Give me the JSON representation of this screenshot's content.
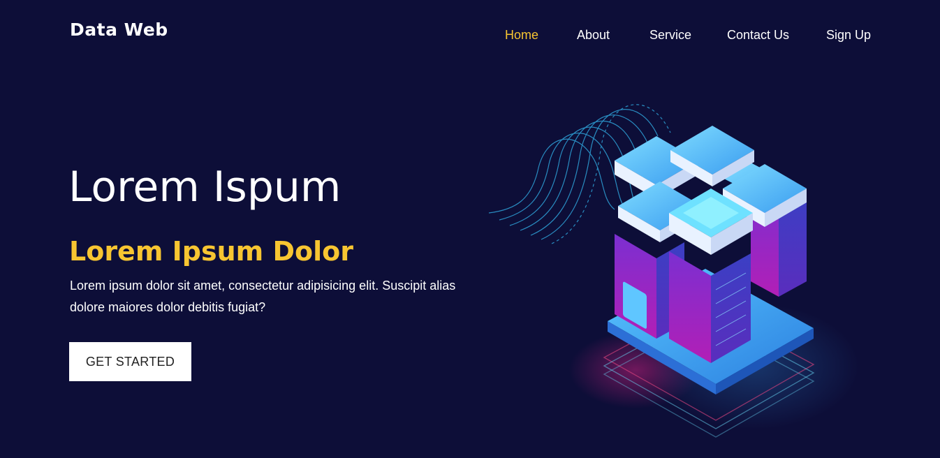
{
  "brand": {
    "name": "Data Web",
    "accent_color": "#f7c531",
    "background_color": "#0d0e38"
  },
  "nav": {
    "items": [
      {
        "label": "Home",
        "active": true
      },
      {
        "label": "About",
        "active": false
      },
      {
        "label": "Service",
        "active": false
      },
      {
        "label": "Contact Us",
        "active": false
      },
      {
        "label": "Sign Up",
        "active": false
      }
    ]
  },
  "hero": {
    "title": "Lorem Ispum",
    "subtitle": "Lorem Ipsum Dolor",
    "description": "Lorem ipsum dolor sit amet, consectetur adipisicing elit. Suscipit alias dolore maiores dolor debitis fugiat?",
    "cta_label": "GET STARTED",
    "illustration": "isometric-server-racks-illustration"
  }
}
